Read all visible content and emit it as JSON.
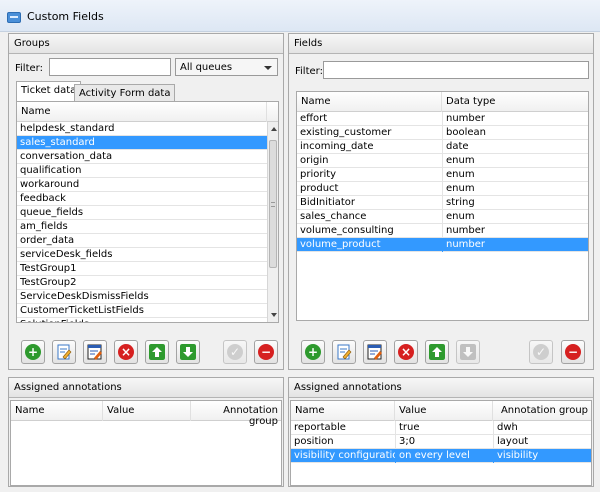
{
  "window": {
    "title": "Custom Fields"
  },
  "groups": {
    "panel_title": "Groups",
    "filter_label": "Filter:",
    "filter_value": "",
    "queue_select": "All queues",
    "tabs": [
      {
        "label": "Ticket data",
        "active": true
      },
      {
        "label": "Activity Form data",
        "active": false
      }
    ],
    "column_name": "Name",
    "items": [
      "helpdesk_standard",
      "sales_standard",
      "conversation_data",
      "qualification",
      "workaround",
      "feedback",
      "queue_fields",
      "am_fields",
      "order_data",
      "serviceDesk_fields",
      "TestGroup1",
      "TestGroup2",
      "ServiceDeskDismissFields",
      "CustomerTicketListFields",
      "SolutionFields"
    ],
    "selected_index": 1
  },
  "fields": {
    "panel_title": "Fields",
    "filter_label": "Filter:",
    "filter_value": "",
    "columns": {
      "name": "Name",
      "type": "Data type"
    },
    "rows": [
      {
        "name": "effort",
        "type": "number"
      },
      {
        "name": "existing_customer",
        "type": "boolean"
      },
      {
        "name": "incoming_date",
        "type": "date"
      },
      {
        "name": "origin",
        "type": "enum"
      },
      {
        "name": "priority",
        "type": "enum"
      },
      {
        "name": "product",
        "type": "enum"
      },
      {
        "name": "BidInitiator",
        "type": "string"
      },
      {
        "name": "sales_chance",
        "type": "enum"
      },
      {
        "name": "volume_consulting",
        "type": "number"
      },
      {
        "name": "volume_product",
        "type": "number"
      }
    ],
    "selected_index": 9
  },
  "toolbar_icons": {
    "add": "plus-circle-icon",
    "edit": "edit-page-icon",
    "edit_batch": "edit-list-icon",
    "delete": "delete-x-icon",
    "move_up": "arrow-up-icon",
    "move_down": "arrow-down-icon",
    "apply": "check-icon",
    "remove": "minus-circle-icon"
  },
  "annotations_left": {
    "panel_title": "Assigned annotations",
    "columns": {
      "name": "Name",
      "value": "Value",
      "group": "Annotation group"
    },
    "rows": []
  },
  "annotations_right": {
    "panel_title": "Assigned annotations",
    "columns": {
      "name": "Name",
      "value": "Value",
      "group": "Annotation group"
    },
    "rows": [
      {
        "name": "reportable",
        "value": "true",
        "group": "dwh"
      },
      {
        "name": "position",
        "value": "3;0",
        "group": "layout"
      },
      {
        "name": "visibility configuration",
        "value": "on every level",
        "group": "visibility"
      }
    ],
    "selected_index": 2
  },
  "colors": {
    "selection": "#3399ff",
    "green": "#2e9a2e",
    "red": "#d62020"
  }
}
